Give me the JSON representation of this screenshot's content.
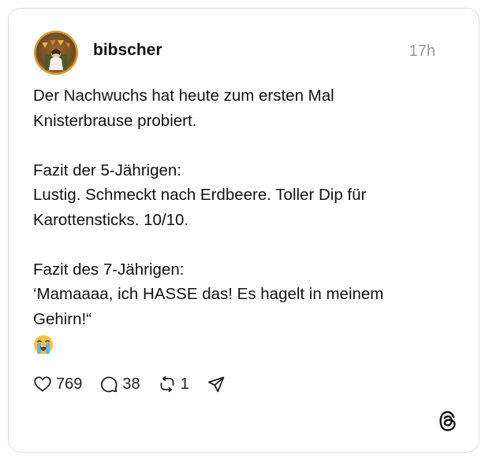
{
  "post": {
    "username": "bibscher",
    "timestamp": "17h",
    "lines": [
      "Der Nachwuchs hat heute zum ersten Mal",
      "Knisterbrause probiert.",
      "",
      "Fazit der 5-Jährigen:",
      "Lustig. Schmeckt nach Erdbeere. Toller Dip für",
      "Karottensticks. 10/10.",
      "",
      "Fazit des 7-Jährigen:",
      "‘Mamaaaa, ich HASSE das! Es hagelt in meinem",
      "Gehirn!“"
    ],
    "emoji": "loudly-crying-face"
  },
  "actions": {
    "likes": "769",
    "replies": "38",
    "reposts": "1"
  },
  "icons": {
    "like": "heart-icon",
    "reply": "comment-icon",
    "repost": "repost-icon",
    "share": "send-icon",
    "brand": "threads-logo-icon"
  },
  "colors": {
    "text": "#111111",
    "muted": "#9a9a9a",
    "border": "#dcdcdc"
  }
}
